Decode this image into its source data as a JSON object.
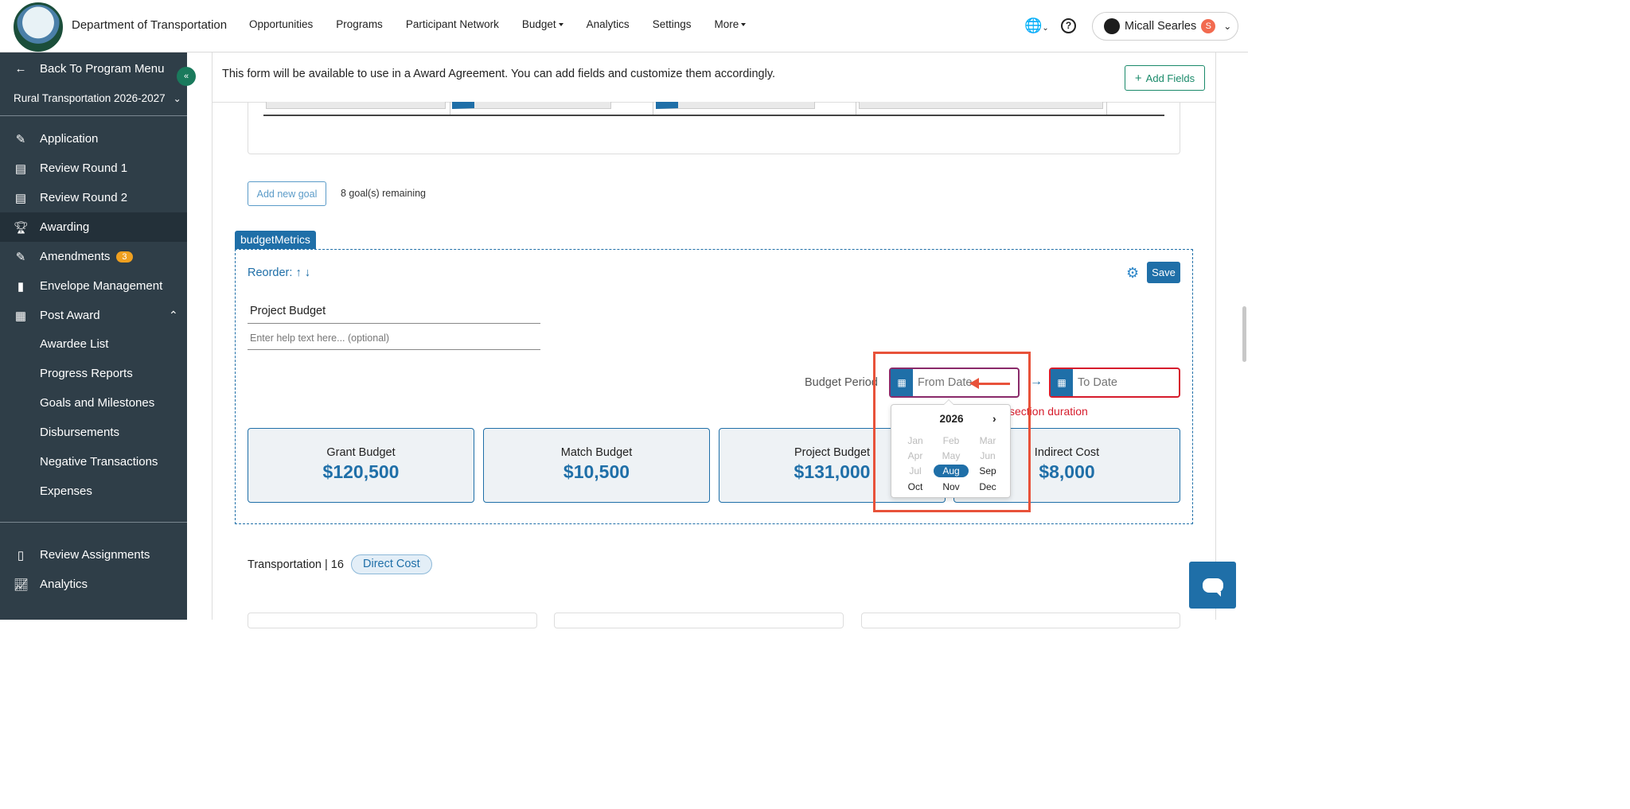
{
  "header": {
    "org_name": "Department of Transportation",
    "nav": [
      "Opportunities",
      "Programs",
      "Participant Network",
      "Budget",
      "Analytics",
      "Settings",
      "More"
    ],
    "user_name": "Micall Searles",
    "user_badge": "S"
  },
  "sidebar": {
    "back_label": "Back To Program Menu",
    "program": "Rural Transportation 2026-2027",
    "items": [
      {
        "label": "Application",
        "icon": "edit-file-icon"
      },
      {
        "label": "Review Round 1",
        "icon": "review-file-icon"
      },
      {
        "label": "Review Round 2",
        "icon": "review-file-icon"
      },
      {
        "label": "Awarding",
        "icon": "trophy-icon"
      },
      {
        "label": "Amendments",
        "icon": "edit-icon",
        "badge": "3"
      },
      {
        "label": "Envelope Management",
        "icon": "file-icon"
      },
      {
        "label": "Post Award",
        "icon": "building-icon"
      }
    ],
    "sub_items": [
      "Awardee List",
      "Progress Reports",
      "Goals and Milestones",
      "Disbursements",
      "Negative Transactions",
      "Expenses"
    ],
    "bottom_items": [
      {
        "label": "Review Assignments",
        "icon": "clipboard-icon"
      },
      {
        "label": "Analytics",
        "icon": "chart-icon"
      }
    ]
  },
  "main": {
    "info_text": "This form will be available to use in a Award Agreement. You can add fields and customize them accordingly.",
    "add_fields_label": "Add Fields",
    "add_goal_label": "Add new goal",
    "goals_remaining": "8 goal(s) remaining",
    "section_tag": "budgetMetrics",
    "reorder_label": "Reorder:",
    "save_label": "Save",
    "project_title": "Project Budget",
    "help_placeholder": "Enter help text here... (optional)",
    "budget_period_label": "Budget Period",
    "from_placeholder": "From Date",
    "to_placeholder": "To Date",
    "error_text": "section duration",
    "metrics": [
      {
        "label": "Grant Budget",
        "value": "$120,500"
      },
      {
        "label": "Match Budget",
        "value": "$10,500"
      },
      {
        "label": "Project Budget",
        "value": "$131,000"
      },
      {
        "label": "Indirect Cost",
        "value": "$8,000"
      }
    ],
    "transport_label": "Transportation | 16",
    "direct_cost_label": "Direct Cost"
  },
  "picker": {
    "year": "2026",
    "months": [
      {
        "label": "Jan",
        "state": "disabled"
      },
      {
        "label": "Feb",
        "state": "disabled"
      },
      {
        "label": "Mar",
        "state": "disabled"
      },
      {
        "label": "Apr",
        "state": "disabled"
      },
      {
        "label": "May",
        "state": "disabled"
      },
      {
        "label": "Jun",
        "state": "disabled"
      },
      {
        "label": "Jul",
        "state": "disabled"
      },
      {
        "label": "Aug",
        "state": "selected"
      },
      {
        "label": "Sep",
        "state": "enabled"
      },
      {
        "label": "Oct",
        "state": "enabled"
      },
      {
        "label": "Nov",
        "state": "enabled"
      },
      {
        "label": "Dec",
        "state": "enabled"
      }
    ]
  },
  "colors": {
    "primary": "#1f6fa8",
    "sidebar_bg": "#2f3e48",
    "error": "#d61c2c",
    "annotation": "#e8523a",
    "accent_green": "#1a8a6a"
  }
}
